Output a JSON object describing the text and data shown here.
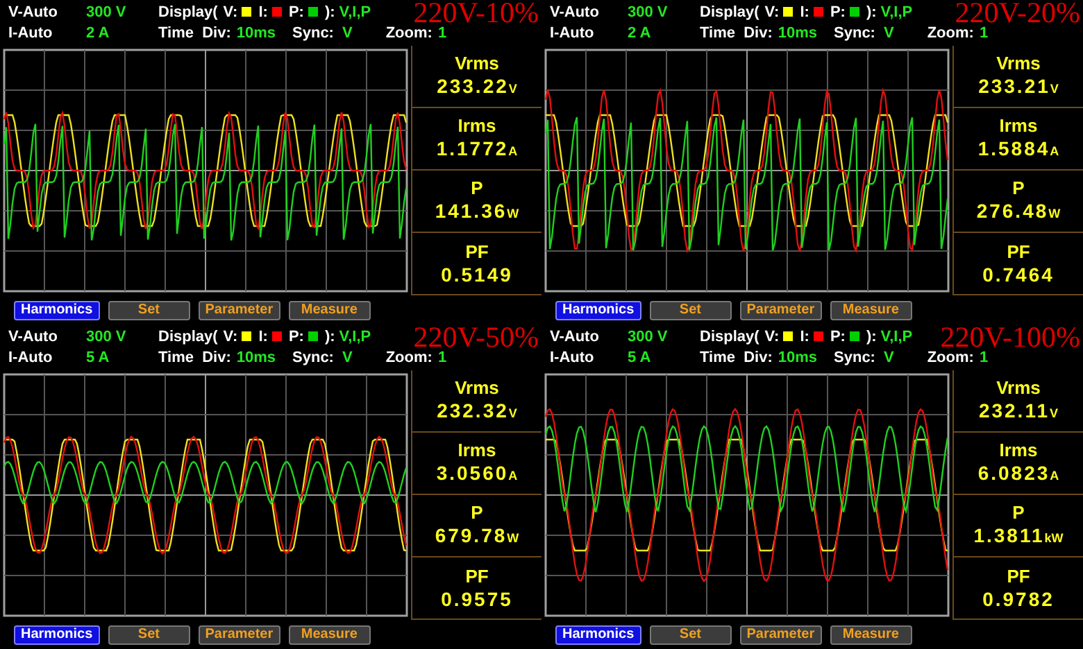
{
  "panels": [
    {
      "title": "220V-10%",
      "v_mode": "V-Auto",
      "v_range": "300 V",
      "display_label": "Display(",
      "legend": [
        {
          "label": "V:",
          "color": "#ffff00"
        },
        {
          "label": "I:",
          "color": "#ff0000"
        },
        {
          "label": "P:",
          "color": "#00d000"
        }
      ],
      "display_close": "):",
      "display_value": "V,I,P",
      "i_mode": "I-Auto",
      "i_range": "2 A",
      "time_div_label": "Time  Div:",
      "time_div": "10ms",
      "sync_label": "Sync:",
      "sync": "V",
      "zoom_label": "Zoom:",
      "zoom": "1",
      "readings": [
        {
          "label": "Vrms",
          "value": "233.22",
          "unit": "V"
        },
        {
          "label": "Irms",
          "value": "1.1772",
          "unit": "A"
        },
        {
          "label": "P",
          "value": "141.36",
          "unit": "W"
        },
        {
          "label": "PF",
          "value": "0.5149"
        }
      ],
      "buttons": [
        {
          "label": "Harmonics",
          "selected": true
        },
        {
          "label": "Set",
          "selected": false
        },
        {
          "label": "Parameter",
          "selected": false
        },
        {
          "label": "Measure",
          "selected": false
        }
      ]
    },
    {
      "title": "220V-20%",
      "v_mode": "V-Auto",
      "v_range": "300 V",
      "display_label": "Display(",
      "legend": [
        {
          "label": "V:",
          "color": "#ffff00"
        },
        {
          "label": "I:",
          "color": "#ff0000"
        },
        {
          "label": "P:",
          "color": "#00d000"
        }
      ],
      "display_close": "):",
      "display_value": "V,I,P",
      "i_mode": "I-Auto",
      "i_range": "2 A",
      "time_div_label": "Time  Div:",
      "time_div": "10ms",
      "sync_label": "Sync:",
      "sync": "V",
      "zoom_label": "Zoom:",
      "zoom": "1",
      "readings": [
        {
          "label": "Vrms",
          "value": "233.21",
          "unit": "V"
        },
        {
          "label": "Irms",
          "value": "1.5884",
          "unit": "A"
        },
        {
          "label": "P",
          "value": "276.48",
          "unit": "W"
        },
        {
          "label": "PF",
          "value": "0.7464"
        }
      ],
      "buttons": [
        {
          "label": "Harmonics",
          "selected": true
        },
        {
          "label": "Set",
          "selected": false
        },
        {
          "label": "Parameter",
          "selected": false
        },
        {
          "label": "Measure",
          "selected": false
        }
      ]
    },
    {
      "title": "220V-50%",
      "v_mode": "V-Auto",
      "v_range": "300 V",
      "display_label": "Display(",
      "legend": [
        {
          "label": "V:",
          "color": "#ffff00"
        },
        {
          "label": "I:",
          "color": "#ff0000"
        },
        {
          "label": "P:",
          "color": "#00d000"
        }
      ],
      "display_close": "):",
      "display_value": "V,I,P",
      "i_mode": "I-Auto",
      "i_range": "5 A",
      "time_div_label": "Time  Div:",
      "time_div": "10ms",
      "sync_label": "Sync:",
      "sync": "V",
      "zoom_label": "Zoom:",
      "zoom": "1",
      "readings": [
        {
          "label": "Vrms",
          "value": "232.32",
          "unit": "V"
        },
        {
          "label": "Irms",
          "value": "3.0560",
          "unit": "A"
        },
        {
          "label": "P",
          "value": "679.78",
          "unit": "W"
        },
        {
          "label": "PF",
          "value": "0.9575"
        }
      ],
      "buttons": [
        {
          "label": "Harmonics",
          "selected": true
        },
        {
          "label": "Set",
          "selected": false
        },
        {
          "label": "Parameter",
          "selected": false
        },
        {
          "label": "Measure",
          "selected": false
        }
      ]
    },
    {
      "title": "220V-100%",
      "v_mode": "V-Auto",
      "v_range": "300 V",
      "display_label": "Display(",
      "legend": [
        {
          "label": "V:",
          "color": "#ffff00"
        },
        {
          "label": "I:",
          "color": "#ff0000"
        },
        {
          "label": "P:",
          "color": "#00d000"
        }
      ],
      "display_close": "):",
      "display_value": "V,I,P",
      "i_mode": "I-Auto",
      "i_range": "5 A",
      "time_div_label": "Time  Div:",
      "time_div": "10ms",
      "sync_label": "Sync:",
      "sync": "V",
      "zoom_label": "Zoom:",
      "zoom": "1",
      "readings": [
        {
          "label": "Vrms",
          "value": "232.11",
          "unit": "V"
        },
        {
          "label": "Irms",
          "value": "6.0823",
          "unit": "A"
        },
        {
          "label": "P",
          "value": "1.3811",
          "unit": "kW"
        },
        {
          "label": "PF",
          "value": "0.9782"
        }
      ],
      "buttons": [
        {
          "label": "Harmonics",
          "selected": true
        },
        {
          "label": "Set",
          "selected": false
        },
        {
          "label": "Parameter",
          "selected": false
        },
        {
          "label": "Measure",
          "selected": false
        }
      ]
    }
  ]
}
